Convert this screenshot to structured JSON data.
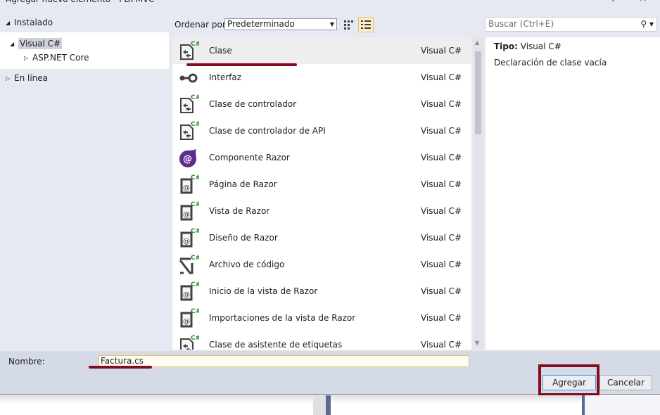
{
  "window": {
    "title": "Agregar nuevo elemento - PDFMVC",
    "help_label": "?",
    "close_label": "✕"
  },
  "tree": {
    "installed": "Instalado",
    "visual_cs": "Visual C#",
    "aspnet_core": "ASP.NET Core",
    "online": "En línea"
  },
  "toolbar": {
    "sort_label": "Ordenar por:",
    "sort_value": "Predeterminado",
    "search_placeholder": "Buscar (Ctrl+E)"
  },
  "templates": [
    {
      "name": "Clase",
      "lang": "Visual C#",
      "icon": "class"
    },
    {
      "name": "Interfaz",
      "lang": "Visual C#",
      "icon": "interface"
    },
    {
      "name": "Clase de controlador",
      "lang": "Visual C#",
      "icon": "class"
    },
    {
      "name": "Clase de controlador de API",
      "lang": "Visual C#",
      "icon": "class"
    },
    {
      "name": "Componente Razor",
      "lang": "Visual C#",
      "icon": "blazor"
    },
    {
      "name": "Página de Razor",
      "lang": "Visual C#",
      "icon": "razor"
    },
    {
      "name": "Vista de Razor",
      "lang": "Visual C#",
      "icon": "razor"
    },
    {
      "name": "Diseño de Razor",
      "lang": "Visual C#",
      "icon": "razor"
    },
    {
      "name": "Archivo de código",
      "lang": "Visual C#",
      "icon": "code-file"
    },
    {
      "name": "Inicio de la vista de Razor",
      "lang": "Visual C#",
      "icon": "razor"
    },
    {
      "name": "Importaciones de la vista de Razor",
      "lang": "Visual C#",
      "icon": "razor"
    },
    {
      "name": "Clase de asistente de etiquetas",
      "lang": "Visual C#",
      "icon": "class"
    }
  ],
  "details": {
    "type_label": "Tipo:",
    "type_value": "Visual C#",
    "description": "Declaración de clase vacía"
  },
  "form": {
    "name_label": "Nombre:",
    "name_value": "Factura.cs",
    "add_button": "Agregar",
    "cancel_button": "Cancelar"
  },
  "colors": {
    "annotation": "#850b20",
    "cs_badge": "#388a34",
    "blazor": "#5c2d91"
  }
}
